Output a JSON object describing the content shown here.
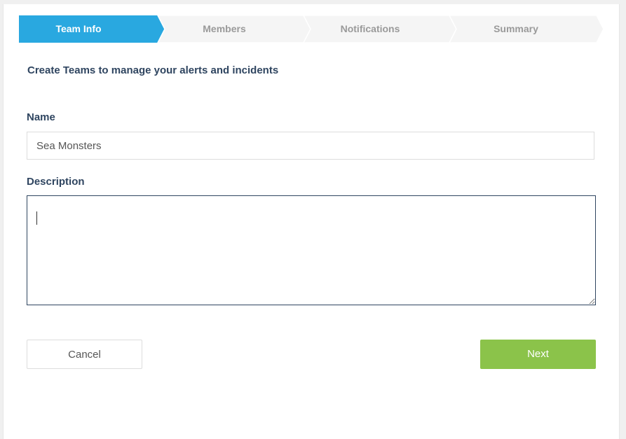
{
  "wizard": {
    "steps": [
      {
        "label": "Team Info",
        "active": true
      },
      {
        "label": "Members",
        "active": false
      },
      {
        "label": "Notifications",
        "active": false
      },
      {
        "label": "Summary",
        "active": false
      }
    ]
  },
  "form": {
    "intro": "Create Teams to manage your alerts and incidents",
    "name_label": "Name",
    "name_value": "Sea Monsters",
    "description_label": "Description",
    "description_value": ""
  },
  "actions": {
    "cancel_label": "Cancel",
    "next_label": "Next"
  },
  "colors": {
    "active_step": "#29a8e0",
    "inactive_step": "#f5f5f5",
    "heading": "#2f4560",
    "next_button": "#8bc34a"
  }
}
